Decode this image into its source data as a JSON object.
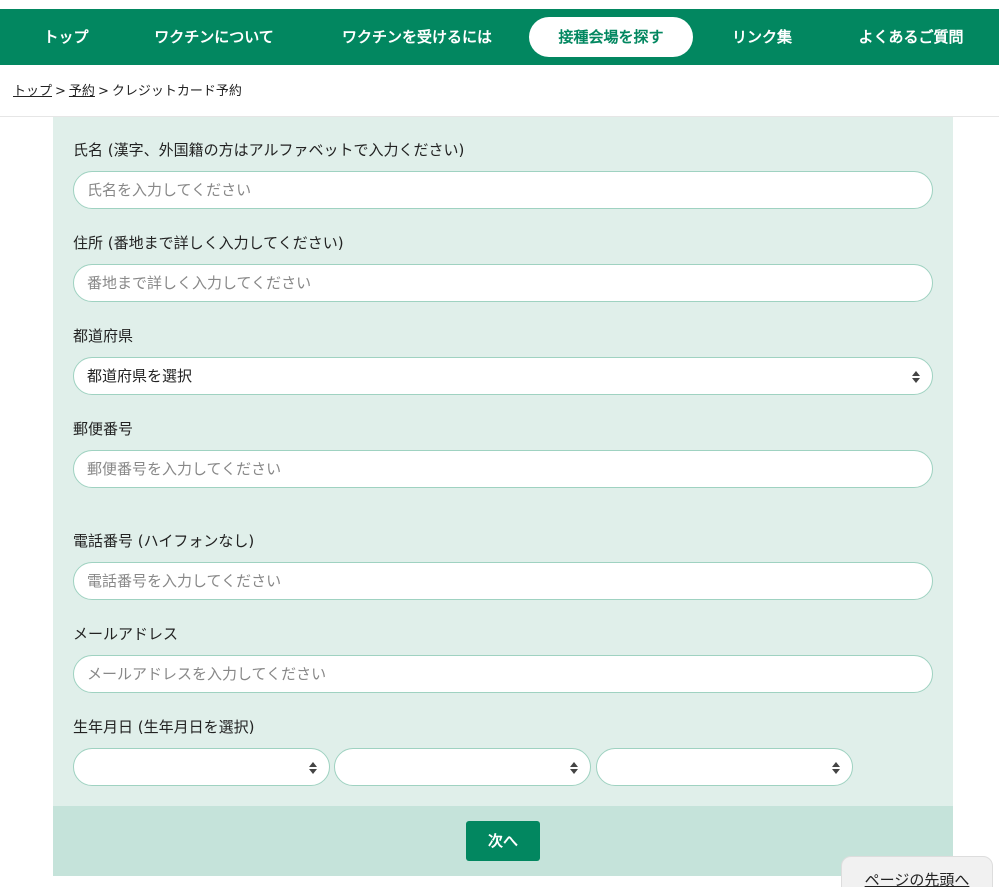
{
  "nav": {
    "items": [
      {
        "label": "トップ"
      },
      {
        "label": "ワクチンについて"
      },
      {
        "label": "ワクチンを受けるには"
      },
      {
        "label": "接種会場を探す"
      },
      {
        "label": "リンク集"
      },
      {
        "label": "よくあるご質問"
      }
    ],
    "active_index": 3
  },
  "breadcrumb": {
    "items": [
      "トップ",
      "予約"
    ],
    "current": "クレジットカード予約",
    "separator": ">"
  },
  "form": {
    "name": {
      "label": "氏名 (漢字、外国籍の方はアルファベットで入力ください)",
      "placeholder": "氏名を入力してください",
      "value": ""
    },
    "address": {
      "label": "住所 (番地まで詳しく入力してください)",
      "placeholder": "番地まで詳しく入力してください",
      "value": ""
    },
    "prefecture": {
      "label": "都道府県",
      "selected": "都道府県を選択"
    },
    "postal": {
      "label": "郵便番号",
      "placeholder": "郵便番号を入力してください",
      "value": ""
    },
    "phone": {
      "label": "電話番号 (ハイフォンなし)",
      "placeholder": "電話番号を入力してください",
      "value": ""
    },
    "email": {
      "label": "メールアドレス",
      "placeholder": "メールアドレスを入力してください",
      "value": ""
    },
    "dob": {
      "label": "生年月日 (生年月日を選択)",
      "year": "",
      "month": "",
      "day": ""
    }
  },
  "actions": {
    "next_label": "次へ"
  },
  "pagetop": {
    "label": "ページの先頭へ"
  },
  "colors": {
    "brand_green": "#028760",
    "panel_bg": "#e0efea",
    "footer_bg": "#c5e3da",
    "field_border": "#9fd2c1"
  }
}
